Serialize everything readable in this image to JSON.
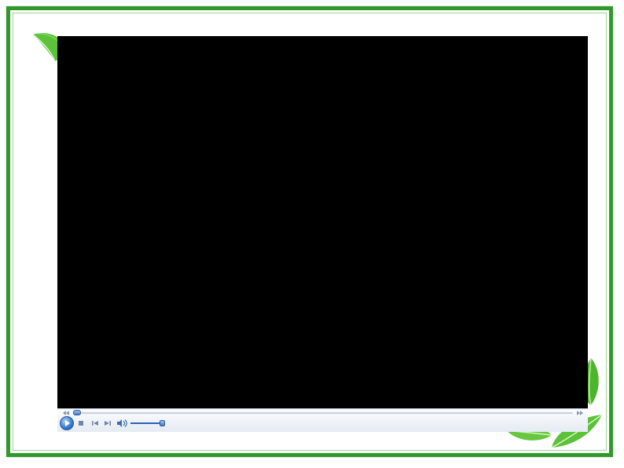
{
  "slide": {
    "border_color": "#2f9a2a",
    "background_color": "#ffffff",
    "decoration": {
      "top_left": "leaf-icon",
      "bottom_right": "leaf-cluster-icon"
    }
  },
  "player": {
    "video_background": "#000000",
    "seek": {
      "position_fraction": 0.01,
      "rewind_icon": "rewind-icon",
      "fast_forward_icon": "fast-forward-icon"
    },
    "controls": {
      "play": "play-icon",
      "stop": "stop-icon",
      "previous": "previous-track-icon",
      "next": "next-track-icon",
      "mute": "speaker-icon"
    },
    "volume_fraction": 1.0,
    "accent_color": "#3f78c6"
  }
}
